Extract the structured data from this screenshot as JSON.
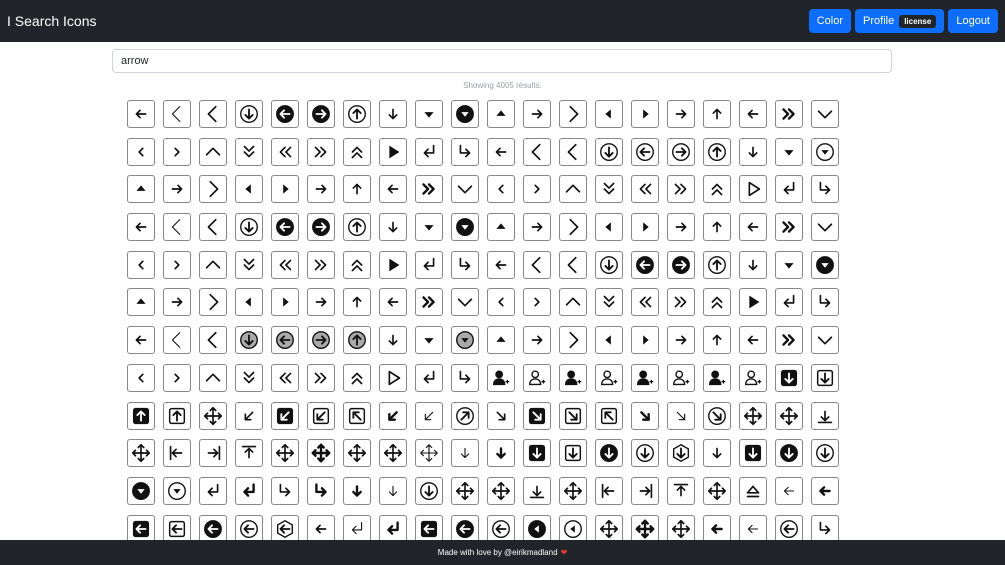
{
  "navbar": {
    "brand": "I Search Icons",
    "color_label": "Color",
    "profile_label": "Profile",
    "profile_badge": "license",
    "logout_label": "Logout"
  },
  "search": {
    "value": "arrow",
    "placeholder": ""
  },
  "results_text": "Showing 4005 results.",
  "footer": {
    "text": "Made with love by @eirikmadland",
    "heart": "❤"
  },
  "colors": {
    "navbar_bg": "#212529",
    "primary": "#0d6efd",
    "heart": "#e53935"
  },
  "icon_rows": [
    [
      "arrow-left",
      "chevron-left-thin",
      "chevron-left",
      "arrow-down-circle",
      "arrow-left-circle-fill",
      "arrow-right-circle-fill",
      "arrow-up-circle",
      "arrow-down",
      "caret-down-fill",
      "caret-down-circle-fill",
      "caret-up-fill",
      "arrow-right",
      "chevron-right",
      "caret-left-fill",
      "caret-right-fill",
      "arrow-right-short",
      "arrow-up",
      "arrow-left-right",
      "chevron-double-right-bold",
      "chevron-down"
    ],
    [
      "chevron-left-small",
      "chevron-right-small",
      "chevron-up",
      "chevron-double-down",
      "chevron-double-left",
      "chevron-double-right",
      "chevron-double-up",
      "play-fill",
      "arrow-return-left",
      "arrow-return-right",
      "arrow-left",
      "chevron-left",
      "chevron-left",
      "arrow-down-circle",
      "arrow-left-circle",
      "arrow-right-circle",
      "arrow-up-circle",
      "arrow-down",
      "caret-down-fill",
      "caret-down-circle"
    ],
    [
      "caret-up-fill",
      "arrow-right",
      "chevron-right",
      "caret-left-fill",
      "caret-right-fill",
      "arrow-right-short",
      "arrow-up",
      "arrow-left-right",
      "chevron-double-right-bold",
      "chevron-down",
      "chevron-left-small",
      "chevron-right-small",
      "chevron-up",
      "chevron-double-down",
      "chevron-double-left",
      "chevron-double-right",
      "chevron-double-up",
      "play",
      "arrow-return-left",
      "arrow-return-right"
    ],
    [
      "arrow-left",
      "chevron-left-thin",
      "chevron-left",
      "arrow-down-circle",
      "arrow-left-circle-fill",
      "arrow-right-circle-fill",
      "arrow-up-circle",
      "arrow-down",
      "caret-down-fill",
      "caret-down-circle-fill",
      "caret-up-fill",
      "arrow-right",
      "chevron-right",
      "caret-left-fill",
      "caret-right-fill",
      "arrow-right-short",
      "arrow-up",
      "arrow-left-right",
      "chevron-double-right-bold",
      "chevron-down"
    ],
    [
      "chevron-left-small",
      "chevron-right-small",
      "chevron-up",
      "chevron-double-down",
      "chevron-double-left",
      "chevron-double-right",
      "chevron-double-up",
      "play-fill",
      "arrow-return-left",
      "arrow-return-right",
      "arrow-left",
      "chevron-left",
      "chevron-left",
      "arrow-down-circle",
      "arrow-left-circle-fill",
      "arrow-right-circle-fill",
      "arrow-up-circle",
      "arrow-down",
      "caret-down-fill",
      "caret-down-circle-fill"
    ],
    [
      "caret-up-fill",
      "arrow-right",
      "chevron-right",
      "caret-left-fill",
      "caret-right-fill",
      "arrow-right-short",
      "arrow-up",
      "arrow-left-right",
      "chevron-double-right-bold",
      "chevron-down",
      "chevron-left-small",
      "chevron-right-small",
      "chevron-up",
      "chevron-double-down",
      "chevron-double-left",
      "chevron-double-right",
      "chevron-double-up",
      "play-fill",
      "arrow-return-left",
      "arrow-return-right"
    ],
    [
      "arrow-left",
      "chevron-left-thin",
      "chevron-left",
      "arrow-down-circle-gray",
      "arrow-left-circle-gray",
      "arrow-right-circle-gray",
      "arrow-up-circle-gray",
      "arrow-down",
      "caret-down-fill",
      "caret-down-circle-gray",
      "caret-up-fill",
      "arrow-right",
      "chevron-right",
      "caret-left-fill",
      "caret-right-fill",
      "arrow-right-short",
      "arrow-up",
      "arrow-left-right",
      "chevron-double-right-bold",
      "chevron-down"
    ],
    [
      "chevron-left-small",
      "chevron-right-small",
      "chevron-up",
      "chevron-double-down",
      "chevron-double-left",
      "chevron-double-right",
      "chevron-double-up",
      "play",
      "arrow-return-left",
      "arrow-return-right",
      "person-arrow-down-fill",
      "person-arrow-down",
      "person-arrow-left-fill",
      "person-arrow-left",
      "person-arrow-right-fill",
      "person-arrow-right",
      "person-arrow-up-fill",
      "person-arrow-up",
      "archive-down-fill",
      "archive-down"
    ],
    [
      "archive-up-fill",
      "archive-up",
      "arrows-move",
      "arrow-down-left",
      "box-arrow-down-left-fill",
      "box-arrow-down-left",
      "box-arrow-up-left",
      "arrow-down-left-bold",
      "arrow-down-left-thin",
      "arrow-up-right-circle",
      "arrow-down-right",
      "box-arrow-down-right-fill",
      "box-arrow-down-right",
      "box-arrow-up-left-alt",
      "arrow-down-right-bold",
      "arrow-down-right-thin",
      "arrow-down-right-circle",
      "arrows-angle-contract",
      "arrows-collapse-all",
      "arrow-bar-down"
    ],
    [
      "arrows-collapse-vertical",
      "arrow-bar-left",
      "arrow-bar-right",
      "arrow-bar-up",
      "arrows-collapse",
      "arrows-move-bold",
      "arrows-up-text",
      "arrows-down-text",
      "arrows-move-thin",
      "arrow-down-thin",
      "arrow-down-bold",
      "box-arrow-down-fill",
      "box-arrow-down",
      "arrow-down-circle-fill",
      "arrow-down-circle",
      "arrow-down-hex",
      "arrow-down-outline",
      "arrow-down-square-fill",
      "arrow-down-circle-fill",
      "arrow-down-circle"
    ],
    [
      "caret-down-circle-fill",
      "caret-down-circle",
      "arrow-turn-left-up",
      "arrow-turn-left-up-bold",
      "arrow-turn-right-down",
      "arrow-turn-right-down-bold",
      "arrow-down-bold",
      "arrow-down-thin",
      "arrow-down-circle",
      "arrows-angle-expand",
      "arrows-fullscreen",
      "arrow-bar-down-open",
      "arrows-expand-horizontal",
      "arrow-bar-left-open",
      "arrow-bar-right-open",
      "arrow-up-bar",
      "arrows-expand-vertical",
      "arrow-eject",
      "arrow-left-thin",
      "arrow-left-bold"
    ],
    [
      "box-arrow-left-fill",
      "box-arrow-left",
      "arrow-left-circle-fill",
      "arrow-left-circle",
      "arrow-left-hex",
      "arrow-left-outline",
      "arrow-return-left-thin",
      "arrow-return-left-bold",
      "box-arrow-left-fill",
      "arrow-left-circle-fill",
      "arrow-left-circle",
      "caret-left-circle-fill",
      "caret-left-circle",
      "arrows-horizontal",
      "arrows-horizontal-bold",
      "arrows-horizontal-outline",
      "arrow-left-bold",
      "arrow-left-thin",
      "arrow-left-circle",
      "arrow-undo"
    ]
  ]
}
